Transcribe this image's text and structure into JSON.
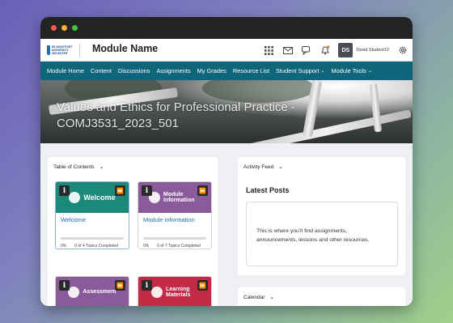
{
  "header": {
    "module_name": "Module Name",
    "user_initials": "DS",
    "user_name": "David Student12",
    "logo_text": "DE MONTFORT UNIVERSITY LEICESTER"
  },
  "nav": {
    "items": [
      {
        "label": "Module Home"
      },
      {
        "label": "Content"
      },
      {
        "label": "Discussions"
      },
      {
        "label": "Assignments"
      },
      {
        "label": "My Grades"
      },
      {
        "label": "Resource List"
      },
      {
        "label": "Student Support",
        "dropdown": true
      },
      {
        "label": "Module Tools",
        "dropdown": true
      }
    ]
  },
  "banner": {
    "title": "Values and Ethics for Professional Practice - COMJ3531_2023_501"
  },
  "toc": {
    "title": "Table of Contents",
    "tiles": [
      {
        "head_label": "Welcome",
        "link": "Welcome",
        "progress_pct": "0%",
        "progress_text": "0 of 4 Topics Completed",
        "color": "#1b8a7b",
        "icon": "waving-hand-icon",
        "progress": 0
      },
      {
        "head_label": "Module Information",
        "link": "Module information",
        "progress_pct": "0%",
        "progress_text": "0 of 7 Topics Completed",
        "color": "#8b5a9a",
        "icon": "info-circle-icon",
        "progress": 0
      },
      {
        "head_label": "Assessment",
        "color": "#8b5a9a",
        "icon": "checkmark-icon"
      },
      {
        "head_label": "Learning Materials",
        "color": "#c22a45",
        "icon": "book-icon"
      }
    ],
    "badge_glyph": "i"
  },
  "feed": {
    "title": "Activity Feed",
    "latest_posts": "Latest Posts",
    "empty_message": "This is where you'll find assignments, announcements, lessons and other resources."
  },
  "calendar": {
    "title": "Calendar"
  },
  "colors": {
    "nav_bg": "#0f6579",
    "link": "#1e6ab8"
  }
}
